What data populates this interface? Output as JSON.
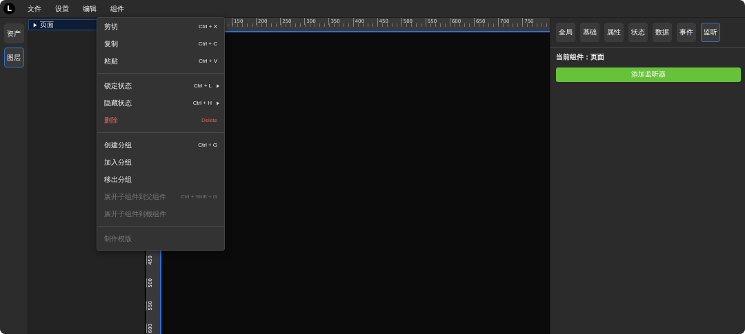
{
  "menubar": {
    "logo": "L",
    "items": [
      "文件",
      "设置",
      "编辑",
      "组件"
    ]
  },
  "rail": [
    {
      "label": "资产",
      "selected": false
    },
    {
      "label": "图层",
      "selected": true
    }
  ],
  "tree": [
    {
      "label": "页面",
      "expanded": false,
      "selected": true
    }
  ],
  "ruler": {
    "horizontal": [
      "150",
      "200",
      "250",
      "300",
      "350",
      "400",
      "450",
      "500",
      "550",
      "600",
      "650",
      "700",
      "750"
    ],
    "vertical": [
      "450",
      "500",
      "550",
      "600"
    ]
  },
  "context_menu": [
    {
      "kind": "item",
      "label": "剪切",
      "shortcut": "Ctrl + X",
      "submenu": false,
      "danger": false,
      "disabled": false
    },
    {
      "kind": "item",
      "label": "复制",
      "shortcut": "Ctrl + C",
      "submenu": false,
      "danger": false,
      "disabled": false
    },
    {
      "kind": "item",
      "label": "粘贴",
      "shortcut": "Ctrl + V",
      "submenu": false,
      "danger": false,
      "disabled": false
    },
    {
      "kind": "separator"
    },
    {
      "kind": "item",
      "label": "锁定状态",
      "shortcut": "Ctrl + L",
      "submenu": true,
      "danger": false,
      "disabled": false
    },
    {
      "kind": "item",
      "label": "隐藏状态",
      "shortcut": "Ctrl + H",
      "submenu": true,
      "danger": false,
      "disabled": false
    },
    {
      "kind": "item",
      "label": "删除",
      "shortcut": "Delete",
      "submenu": false,
      "danger": true,
      "disabled": false
    },
    {
      "kind": "separator"
    },
    {
      "kind": "item",
      "label": "创建分组",
      "shortcut": "Ctrl + G",
      "submenu": false,
      "danger": false,
      "disabled": false
    },
    {
      "kind": "item",
      "label": "加入分组",
      "submenu": false,
      "danger": false,
      "disabled": false
    },
    {
      "kind": "item",
      "label": "移出分组",
      "submenu": false,
      "danger": false,
      "disabled": false
    },
    {
      "kind": "item",
      "label": "展开子组件到父组件",
      "shortcut": "Ctrl + Shift + G",
      "submenu": false,
      "danger": false,
      "disabled": true
    },
    {
      "kind": "item",
      "label": "展开子组件到根组件",
      "submenu": false,
      "danger": false,
      "disabled": true
    },
    {
      "kind": "separator"
    },
    {
      "kind": "item",
      "label": "制作模版",
      "submenu": false,
      "danger": false,
      "disabled": true
    }
  ],
  "inspector": {
    "tabs": [
      {
        "label": "全局",
        "selected": false
      },
      {
        "label": "基础",
        "selected": false
      },
      {
        "label": "属性",
        "selected": false
      },
      {
        "label": "状态",
        "selected": false
      },
      {
        "label": "数据",
        "selected": false
      },
      {
        "label": "事件",
        "selected": false
      },
      {
        "label": "监听",
        "selected": true
      }
    ],
    "current_component": "当前组件：页面",
    "add_button": "添加监听器"
  }
}
